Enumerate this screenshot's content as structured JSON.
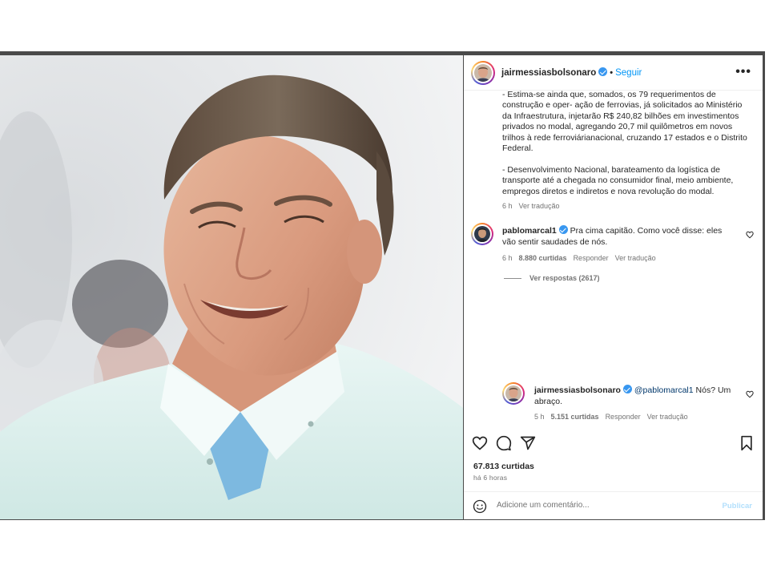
{
  "post": {
    "author": "jairmessiasbolsonaro",
    "follow_label": "Seguir",
    "separator": "•",
    "more_label": "•••"
  },
  "caption": {
    "paragraphs": [
      "- Estima-se ainda que, somados, os 79 requerimentos de construção e oper- ação de ferrovias, já solicitados ao Ministério da Infraestrutura, injetarão R$ 240,82 bilhões em investimentos privados no modal, agregando 20,7 mil quilômetros em novos trilhos à rede ferroviárianacional, cruzando 17 estados e o Distrito Federal.",
      "- Desenvolvimento Nacional, barateamento da logística de transporte até a chegada no consumidor final, meio ambiente, empregos diretos e indiretos e nova revolução do modal."
    ],
    "time": "6 h",
    "translate": "Ver tradução"
  },
  "comments": [
    {
      "user": "pablomarcal1",
      "text": "Pra cima capitão. Como você disse: eles vão sentir saudades de nós.",
      "time": "6 h",
      "likes": "8.880 curtidas",
      "reply": "Responder",
      "translate": "Ver tradução"
    }
  ],
  "view_replies": "Ver respostas (2617)",
  "reply": {
    "user": "jairmessiasbolsonaro",
    "mention": "@pablomarcal1",
    "text": "Nós? Um abraço.",
    "time": "5 h",
    "likes": "5.151 curtidas",
    "reply": "Responder",
    "translate": "Ver tradução"
  },
  "engagement": {
    "likes": "67.813 curtidas",
    "time_ago": "há 6 horas"
  },
  "comment_box": {
    "placeholder": "Adicione um comentário...",
    "publish": "Publicar"
  },
  "colors": {
    "link": "#0095f6",
    "verified": "#3897f0",
    "muted": "#737373",
    "publish_disabled": "#b2dffc"
  },
  "icons": [
    "heart-icon",
    "comment-icon",
    "share-icon",
    "bookmark-icon",
    "emoji-icon",
    "verified-icon",
    "more-options-icon"
  ]
}
